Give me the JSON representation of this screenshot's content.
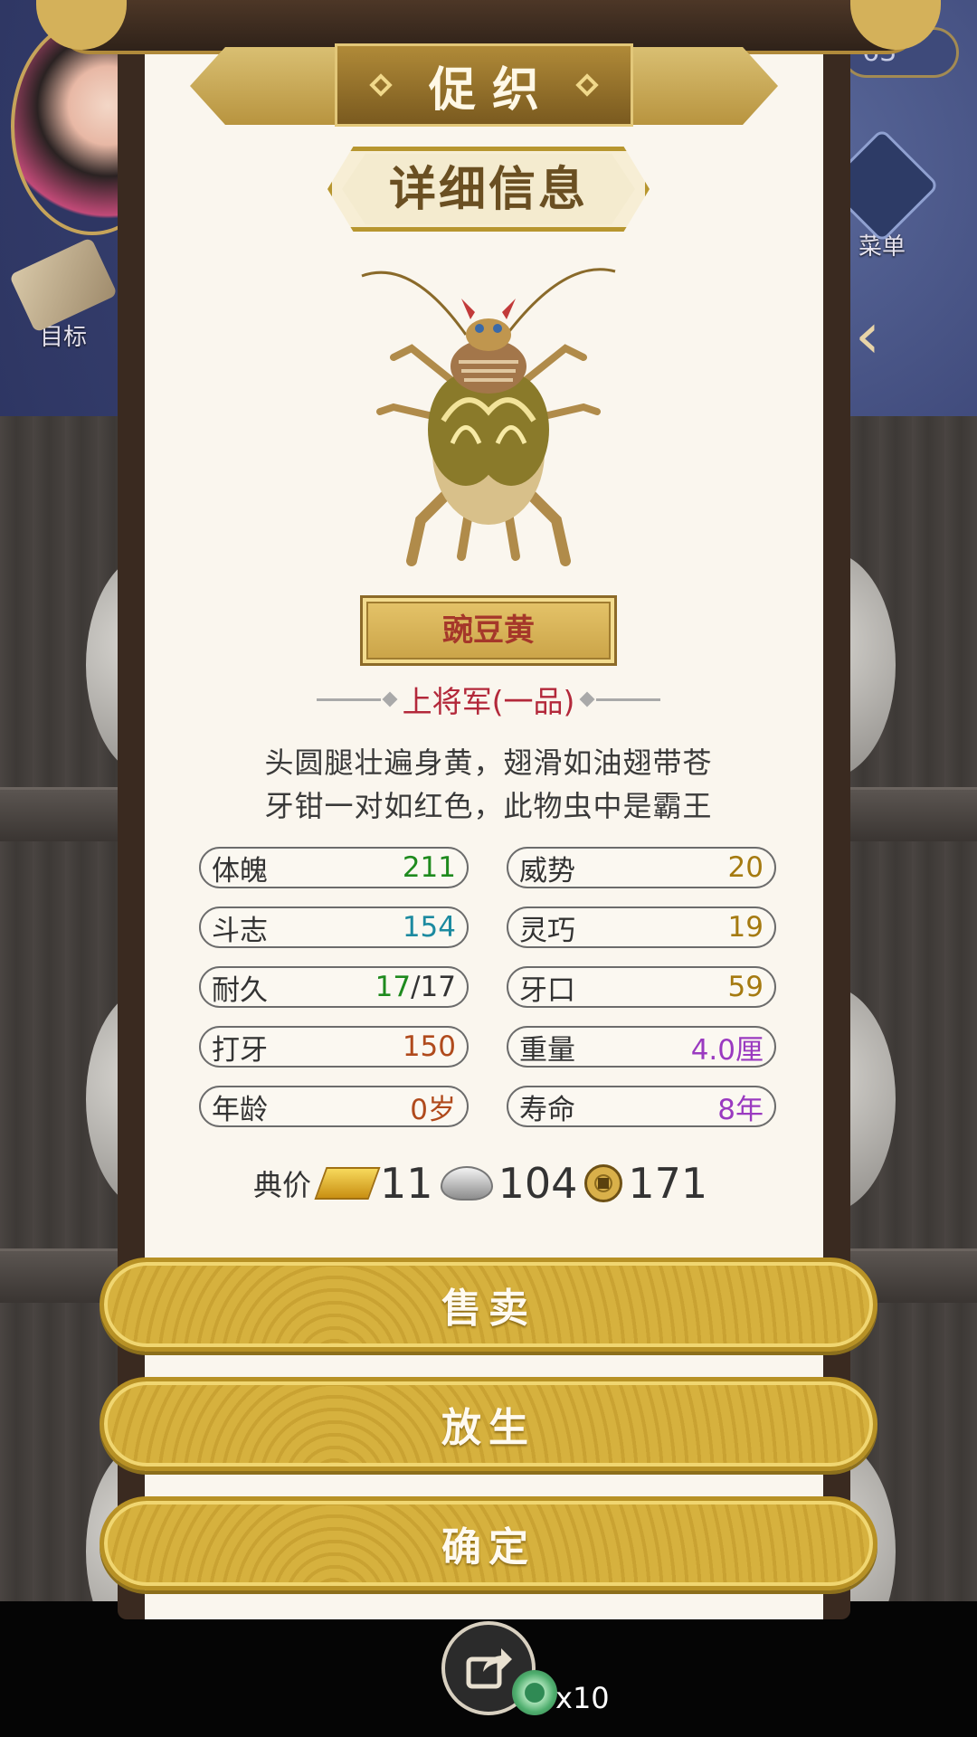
{
  "header": {
    "title": "促织",
    "currency_partial": "63"
  },
  "side": {
    "target_label": "目标",
    "menu_label": "菜单"
  },
  "detail": {
    "heading": "详细信息",
    "cricket_name": "豌豆黄",
    "rank": "上将军(一品)",
    "description": [
      "头圆腿壮遍身黄，翅滑如油翅带苍",
      "牙钳一对如红色，此物虫中是霸王"
    ],
    "stats": [
      {
        "label": "体魄",
        "value": "211",
        "color": "#1e8a1e"
      },
      {
        "label": "威势",
        "value": "20",
        "color": "#a57a10"
      },
      {
        "label": "斗志",
        "value": "154",
        "color": "#1c8aa0"
      },
      {
        "label": "灵巧",
        "value": "19",
        "color": "#a57a10"
      },
      {
        "label": "耐久",
        "value": "17",
        "value_total": "/17",
        "color": "#1e8a1e"
      },
      {
        "label": "牙口",
        "value": "59",
        "color": "#a57a10"
      },
      {
        "label": "打牙",
        "value": "150",
        "color": "#b04a1c"
      },
      {
        "label": "重量",
        "value": "4.0厘",
        "color": "#9a3ac0"
      },
      {
        "label": "年龄",
        "value": "0岁",
        "color": "#b04a1c"
      },
      {
        "label": "寿命",
        "value": "8年",
        "color": "#9a3ac0"
      }
    ],
    "price": {
      "label": "典价",
      "gold": "11",
      "silver": "104",
      "copper": "171"
    }
  },
  "actions": {
    "sell": "售卖",
    "release": "放生",
    "confirm": "确定"
  },
  "bottom": {
    "jade_count": "x10"
  },
  "icons": [
    "gold-bar-icon",
    "silver-ingot-icon",
    "copper-coin-icon",
    "share-icon",
    "jade-icon",
    "menu-icon",
    "target-icon",
    "back-arrow-icon"
  ]
}
